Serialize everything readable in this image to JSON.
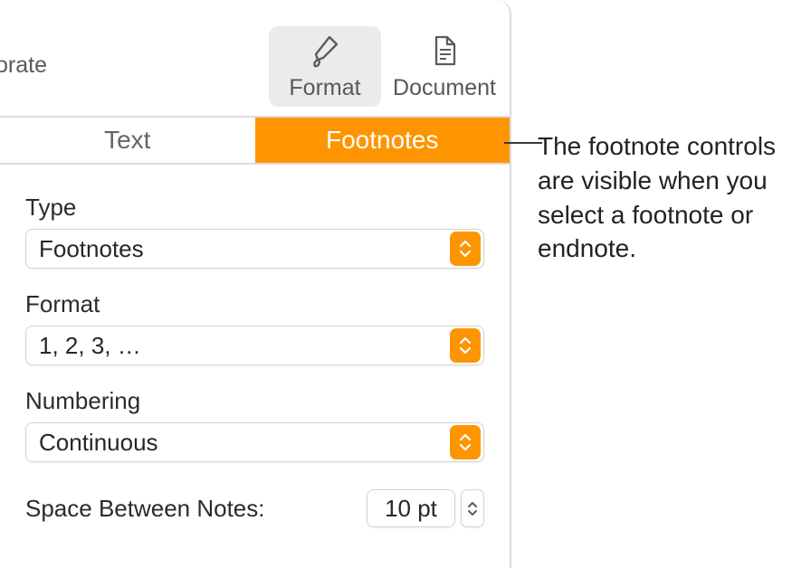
{
  "toolbar": {
    "decorate_fragment": "orate",
    "format_label": "Format",
    "document_label": "Document"
  },
  "tabs": {
    "text_label": "Text",
    "footnotes_label": "Footnotes"
  },
  "fields": {
    "type_label": "Type",
    "type_value": "Footnotes",
    "format_label": "Format",
    "format_value": "1, 2, 3, …",
    "numbering_label": "Numbering",
    "numbering_value": "Continuous",
    "space_label": "Space Between Notes:",
    "space_value": "10 pt"
  },
  "callout": {
    "text": "The footnote controls are visible when you select a footnote or endnote."
  }
}
